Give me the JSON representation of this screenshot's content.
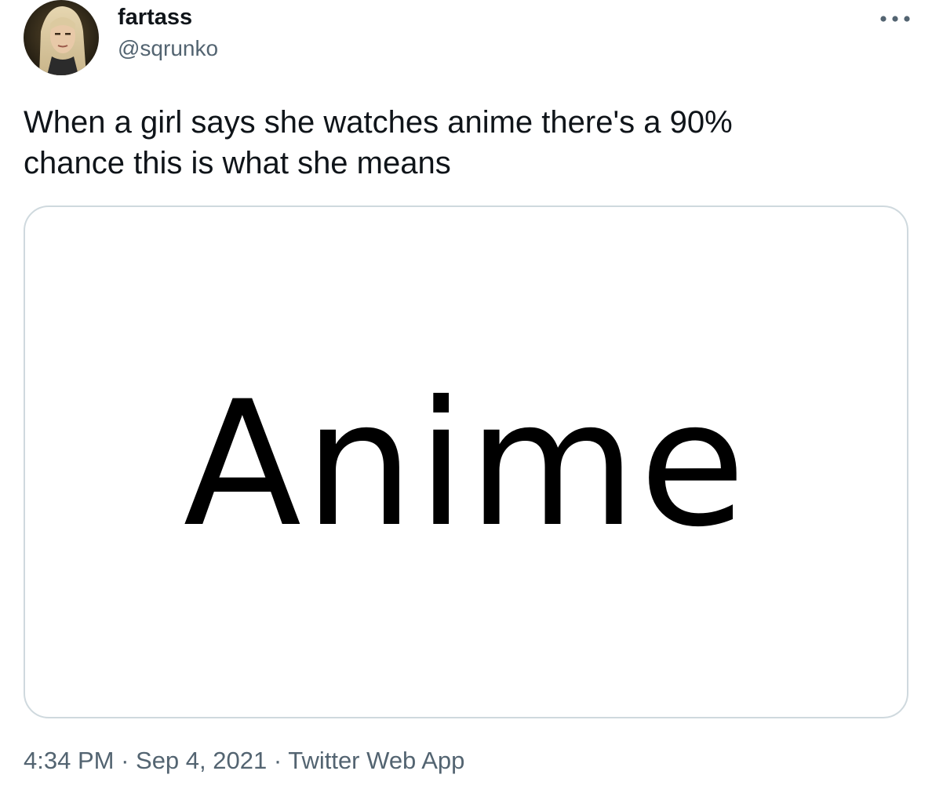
{
  "author": {
    "display_name": "fartass",
    "handle": "@sqrunko"
  },
  "tweet": {
    "text": "When a girl says she watches anime there's a 90%\nchance this is what she means",
    "media_text": "Anime"
  },
  "meta": {
    "time": "4:34 PM",
    "separator": " · ",
    "date": "Sep 4, 2021",
    "source": "Twitter Web App"
  },
  "icons": {
    "more": "more-horizontal-icon",
    "avatar": "profile-avatar"
  },
  "colors": {
    "primary_text": "#0f1419",
    "secondary_text": "#536471",
    "card_border": "#cfd9de"
  }
}
